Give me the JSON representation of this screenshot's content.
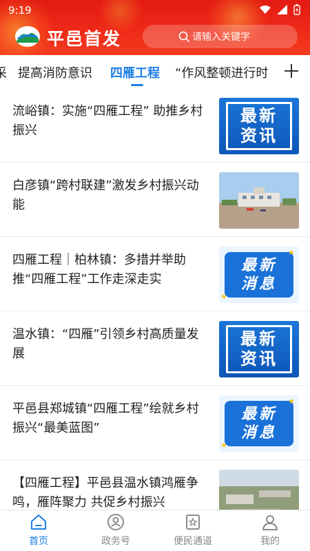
{
  "status_bar": {
    "time": "9:19"
  },
  "header": {
    "app_title": "平邑首发",
    "search_placeholder": "请输入关键字",
    "colors": {
      "background": "#e62215",
      "accent": "#1c7ee6"
    }
  },
  "tabs": {
    "items": [
      {
        "label": "采"
      },
      {
        "label": "提高消防意识"
      },
      {
        "label": "四雁工程"
      },
      {
        "label": "“作风整顿进行时"
      }
    ],
    "active_index": 2
  },
  "news": [
    {
      "title": "流峪镇：实施“四雁工程” 助推乡村振兴",
      "thumb": {
        "type": "badge-zuixin-zixun",
        "line1": "最新",
        "line2": "资讯"
      }
    },
    {
      "title": "白彦镇“跨村联建”激发乡村振兴动能",
      "thumb": {
        "type": "photo-building"
      }
    },
    {
      "title": "四雁工程｜柏林镇：多措并举助推“四雁工程”工作走深走实",
      "thumb": {
        "type": "badge-zuixin-xiaoxi",
        "line1": "最新",
        "line2": "消息"
      }
    },
    {
      "title": "温水镇：“四雁”引领乡村高质量发展",
      "thumb": {
        "type": "badge-zuixin-zixun",
        "line1": "最新",
        "line2": "资讯"
      }
    },
    {
      "title": "平邑县郑城镇“四雁工程”绘就乡村振兴“最美蓝图”",
      "thumb": {
        "type": "badge-zuixin-xiaoxi",
        "line1": "最新",
        "line2": "消息"
      }
    },
    {
      "title": "【四雁工程】平邑县温水镇鸿雁争鸣，雁阵聚力 共促乡村振兴",
      "thumb": {
        "type": "photo-aerial"
      }
    }
  ],
  "bottom_nav": {
    "items": [
      {
        "label": "首页",
        "icon": "home-icon"
      },
      {
        "label": "政务号",
        "icon": "gov-account-icon"
      },
      {
        "label": "便民通道",
        "icon": "service-channel-icon"
      },
      {
        "label": "我的",
        "icon": "profile-icon"
      }
    ],
    "active_index": 0
  }
}
